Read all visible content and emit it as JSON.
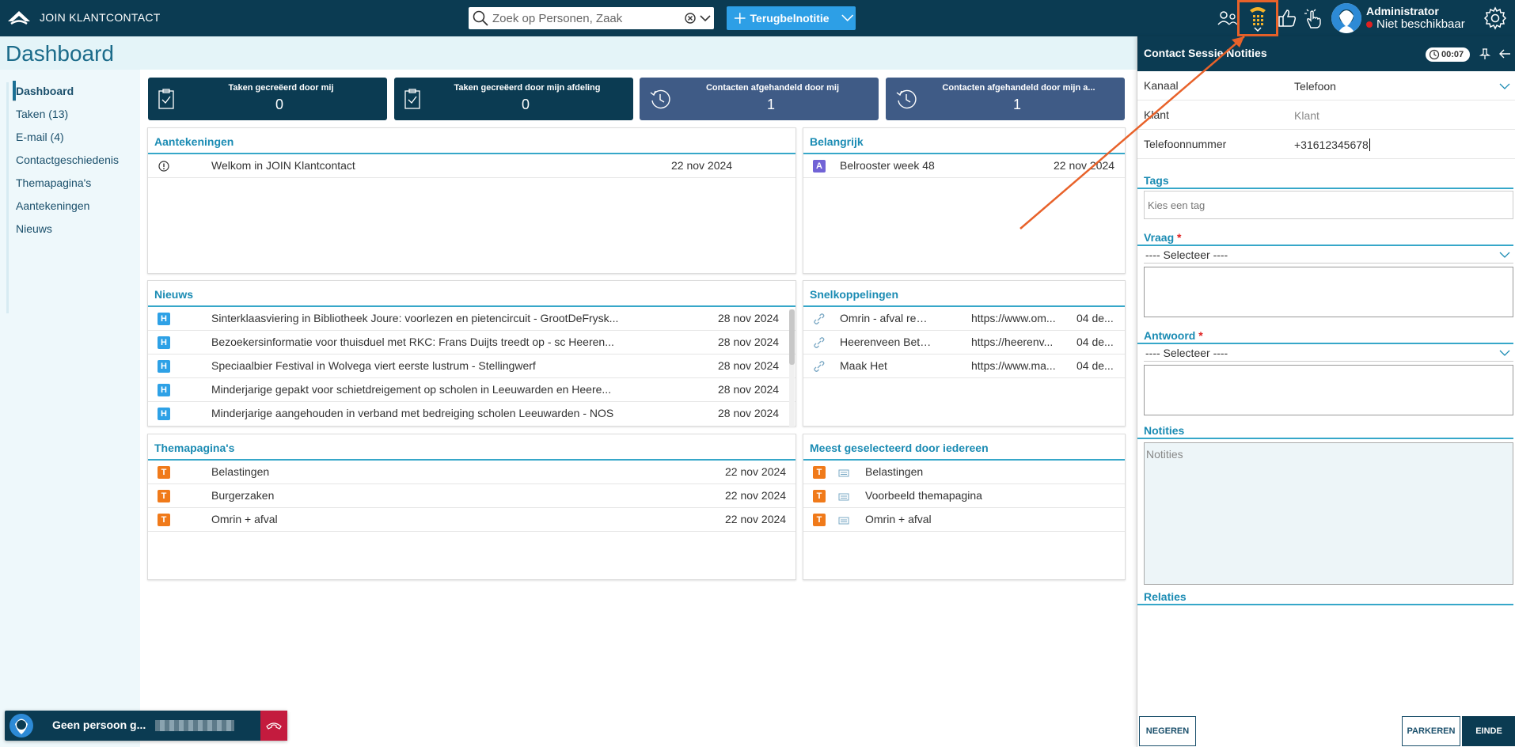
{
  "app": {
    "title": "JOIN KLANTCONTACT"
  },
  "search": {
    "placeholder": "Zoek op Personen, Zaak"
  },
  "toolbar": {
    "callback_label": "Terugbelnotitie"
  },
  "user": {
    "name": "Administrator",
    "status": "Niet beschikbaar",
    "status_color": "#e02020"
  },
  "page": {
    "title": "Dashboard"
  },
  "sidebar": {
    "items": [
      {
        "label": "Dashboard"
      },
      {
        "label": "Taken (13)"
      },
      {
        "label": "E-mail (4)"
      },
      {
        "label": "Contactgeschiedenis"
      },
      {
        "label": "Themapagina's"
      },
      {
        "label": "Aantekeningen"
      },
      {
        "label": "Nieuws"
      }
    ]
  },
  "tiles": [
    {
      "title": "Taken gecreëerd door mij",
      "value": "0",
      "icon": "clipboard-check-icon",
      "color": "#0b3b52"
    },
    {
      "title": "Taken gecreëerd door mijn afdeling",
      "value": "0",
      "icon": "clipboard-check-icon",
      "color": "#0b3b52"
    },
    {
      "title": "Contacten afgehandeld door mij",
      "value": "1",
      "icon": "history-icon",
      "color": "#3f5b86"
    },
    {
      "title": "Contacten afgehandeld door mijn a...",
      "value": "1",
      "icon": "history-icon",
      "color": "#3f5b86"
    }
  ],
  "aantekeningen": {
    "title": "Aantekeningen",
    "rows": [
      {
        "text": "Welkom in JOIN Klantcontact",
        "date": "22 nov 2024"
      }
    ]
  },
  "belangrijk": {
    "title": "Belangrijk",
    "rows": [
      {
        "badge": "A",
        "text": "Belrooster week 48",
        "date": "22 nov 2024"
      }
    ]
  },
  "nieuws": {
    "title": "Nieuws",
    "rows": [
      {
        "badge": "H",
        "text": "Sinterklaasviering in Bibliotheek Joure: voorlezen en pietencircuit - GrootDeFrysk...",
        "date": "28 nov 2024"
      },
      {
        "badge": "H",
        "text": "Bezoekersinformatie voor thuisduel met RKC: Frans Duijts treedt op - sc Heeren...",
        "date": "28 nov 2024"
      },
      {
        "badge": "H",
        "text": "Speciaalbier Festival in Wolvega viert eerste lustrum - Stellingwerf",
        "date": "28 nov 2024"
      },
      {
        "badge": "H",
        "text": "Minderjarige gepakt voor schietdreigement op scholen in Leeuwarden en Heere...",
        "date": "28 nov 2024"
      },
      {
        "badge": "H",
        "text": "Minderjarige aangehouden in verband met bedreiging scholen Leeuwarden - NOS",
        "date": "28 nov 2024"
      }
    ]
  },
  "snelkoppelingen": {
    "title": "Snelkoppelingen",
    "rows": [
      {
        "text": "Omrin - afval regelen ...",
        "url": "https://www.om...",
        "date": "04 de..."
      },
      {
        "text": "Heerenveen Beter Be...",
        "url": "https://heerenv...",
        "date": "04 de..."
      },
      {
        "text": "Maak Het",
        "url": "https://www.ma...",
        "date": "04 de..."
      }
    ]
  },
  "themapaginas": {
    "title": "Themapagina's",
    "rows": [
      {
        "badge": "T",
        "text": "Belastingen",
        "date": "22 nov 2024"
      },
      {
        "badge": "T",
        "text": "Burgerzaken",
        "date": "22 nov 2024"
      },
      {
        "badge": "T",
        "text": "Omrin + afval",
        "date": "22 nov 2024"
      }
    ]
  },
  "meest": {
    "title": "Meest geselecteerd door iedereen",
    "rows": [
      {
        "badge": "T",
        "text": "Belastingen"
      },
      {
        "badge": "T",
        "text": "Voorbeeld themapagina"
      },
      {
        "badge": "T",
        "text": "Omrin + afval"
      }
    ]
  },
  "callbar": {
    "text": "Geen persoon g..."
  },
  "session": {
    "title": "Contact Sessie Notities",
    "timer": "00:07",
    "kanaal_label": "Kanaal",
    "kanaal_value": "Telefoon",
    "klant_label": "Klant",
    "klant_placeholder": "Klant",
    "tel_label": "Telefoonnummer",
    "tel_value": "+31612345678",
    "tags_label": "Tags",
    "tags_placeholder": "Kies een tag",
    "vraag_label": "Vraag",
    "vraag_select": "---- Selecteer ----",
    "antwoord_label": "Antwoord",
    "antwoord_select": "---- Selecteer ----",
    "notities_label": "Notities",
    "notities_placeholder": "Notities",
    "relaties_label": "Relaties",
    "required_mark": "*",
    "btn_negeren": "NEGEREN",
    "btn_parkeren": "PARKEREN",
    "btn_einde": "EINDE"
  },
  "colors": {
    "navy": "#0b3b52",
    "accent": "#2d9fe6",
    "link_heading": "#1a8bb3",
    "annotation": "#e8622a"
  }
}
